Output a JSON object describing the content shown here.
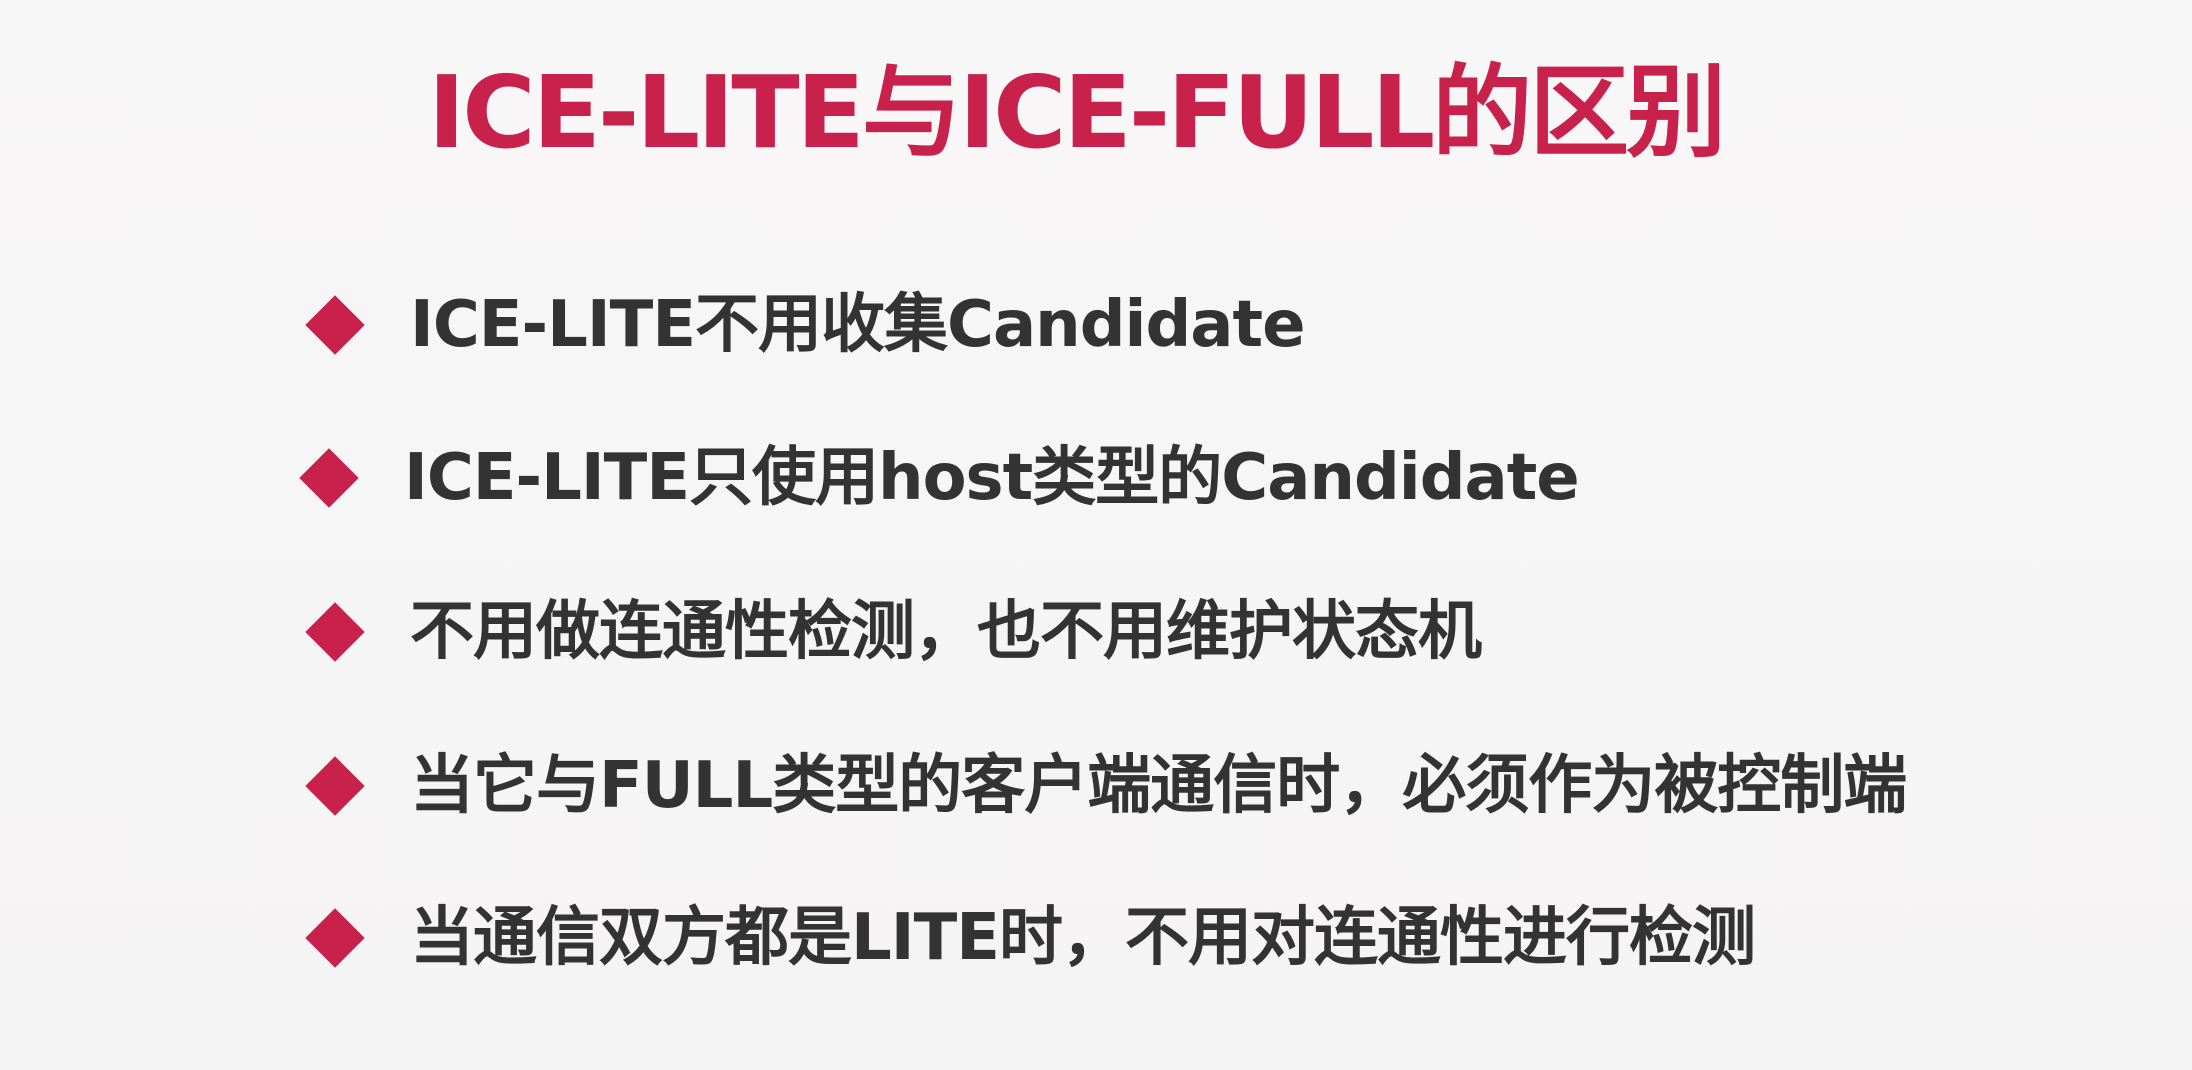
{
  "slide": {
    "title": "ICE-LITE与ICE-FULL的区别",
    "accent_color": "#c8224c",
    "text_color": "#333333",
    "bullet_icon": "diamond-bullet-icon",
    "bullets": [
      "ICE-LITE不用收集Candidate",
      "ICE-LITE只使用host类型的Candidate",
      "不用做连通性检测，也不用维护状态机",
      "当它与FULL类型的客户端通信时，必须作为被控制端",
      "当通信双方都是LITE时，不用对连通性进行检测"
    ]
  }
}
